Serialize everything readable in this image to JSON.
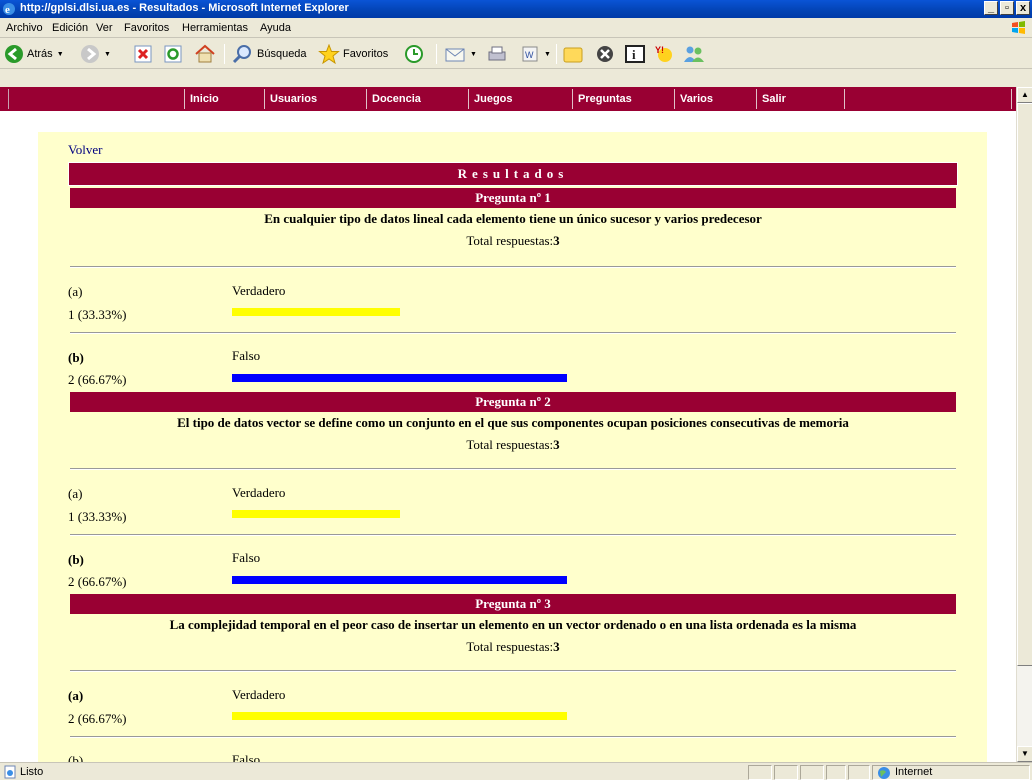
{
  "window": {
    "title": "http://gplsi.dlsi.ua.es - Resultados - Microsoft Internet Explorer",
    "controls": [
      "_",
      "ȅ",
      "x"
    ]
  },
  "menu": [
    "Archivo",
    "Edición",
    "Ver",
    "Favoritos",
    "Herramientas",
    "Ayuda"
  ],
  "toolbar": {
    "back_label": "Atrás",
    "search_label": "Búsqueda",
    "favorites_label": "Favoritos"
  },
  "nav": [
    "Inicio",
    "Usuarios",
    "Docencia",
    "Juegos",
    "Preguntas",
    "Varios",
    "Salir"
  ],
  "page": {
    "volver": "Volver",
    "header": "Resultados",
    "total_label": "Total respuestas:",
    "questions": [
      {
        "heading": "Pregunta nº 1",
        "text": "En cualquier tipo de datos lineal cada elemento tiene un único sucesor y varios predecesor",
        "total": "3",
        "options": [
          {
            "letter": "(a)",
            "label": "Verdadero",
            "count": "1 (33.33%)",
            "fraction": 0.3333,
            "color": "#ffff00",
            "bold": false
          },
          {
            "letter": "(b)",
            "label": "Falso",
            "count": "2 (66.67%)",
            "fraction": 0.6667,
            "color": "#0000ff",
            "bold": true
          }
        ]
      },
      {
        "heading": "Pregunta nº 2",
        "text": "El tipo de datos vector se define como un conjunto en el que sus componentes ocupan posiciones consecutivas de memoria",
        "total": "3",
        "options": [
          {
            "letter": "(a)",
            "label": "Verdadero",
            "count": "1 (33.33%)",
            "fraction": 0.3333,
            "color": "#ffff00",
            "bold": false
          },
          {
            "letter": "(b)",
            "label": "Falso",
            "count": "2 (66.67%)",
            "fraction": 0.6667,
            "color": "#0000ff",
            "bold": true
          }
        ]
      },
      {
        "heading": "Pregunta nº 3",
        "text": "La complejidad temporal en el peor caso de insertar un elemento en un vector ordenado o en una lista ordenada es la misma",
        "total": "3",
        "options": [
          {
            "letter": "(a)",
            "label": "Verdadero",
            "count": "2 (66.67%)",
            "fraction": 0.6667,
            "color": "#ffff00",
            "bold": true
          },
          {
            "letter": "(b)",
            "label": "Falso",
            "count": "",
            "fraction": 0,
            "color": "#0000ff",
            "bold": false
          }
        ]
      }
    ]
  },
  "status": {
    "text": "Listo",
    "zone": "Internet"
  },
  "colors": {
    "brand": "#990033",
    "page_bg": "#ffffcc",
    "bar_a": "#ffff00",
    "bar_b": "#0000ff"
  }
}
